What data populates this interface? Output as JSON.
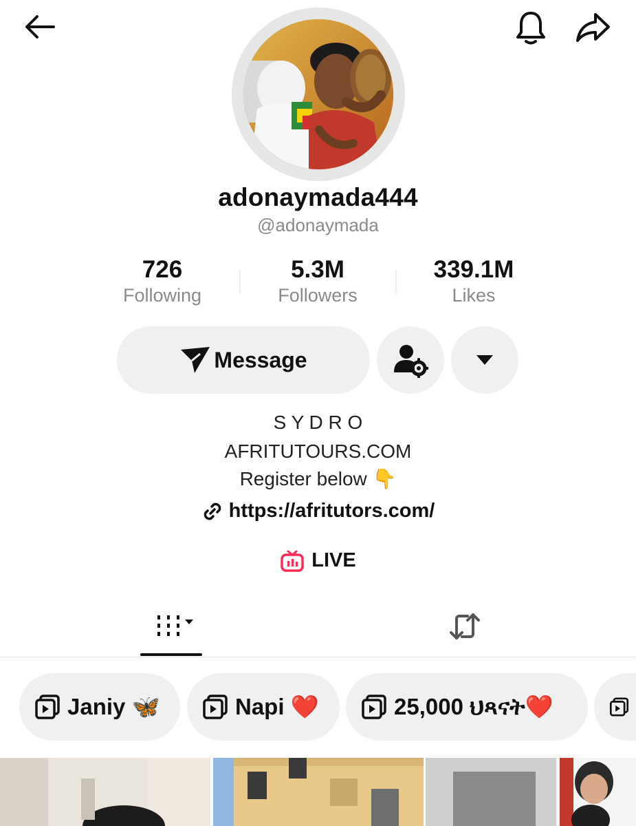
{
  "header": {
    "back_icon": "arrow-left-icon",
    "bell_icon": "bell-icon",
    "share_icon": "share-arrow-icon"
  },
  "profile": {
    "display_name": "adonaymada444",
    "handle": "@adonaymada"
  },
  "stats": [
    {
      "value": "726",
      "label": "Following"
    },
    {
      "value": "5.3M",
      "label": "Followers"
    },
    {
      "value": "339.1M",
      "label": "Likes"
    }
  ],
  "actions": {
    "message_label": "Message",
    "message_icon": "paper-plane-icon",
    "friend_settings_icon": "user-gear-icon",
    "more_icon": "caret-down-icon"
  },
  "bio": {
    "line1": "S Y D R O",
    "line2": "AFRITUTOURS.COM",
    "line3": "Register below 👇",
    "link": "https://afritutors.com/",
    "link_icon": "link-icon"
  },
  "live": {
    "label": "LIVE",
    "icon": "tv-live-icon",
    "color": "#fe2c55"
  },
  "tabs": {
    "videos_icon": "grid-bars-icon",
    "reposts_icon": "repost-icon"
  },
  "playlists": [
    {
      "label": "Janiy 🦋"
    },
    {
      "label": "Napi ❤️"
    },
    {
      "label": "25,000 ህጻናት❤️"
    },
    {
      "label": ""
    }
  ]
}
